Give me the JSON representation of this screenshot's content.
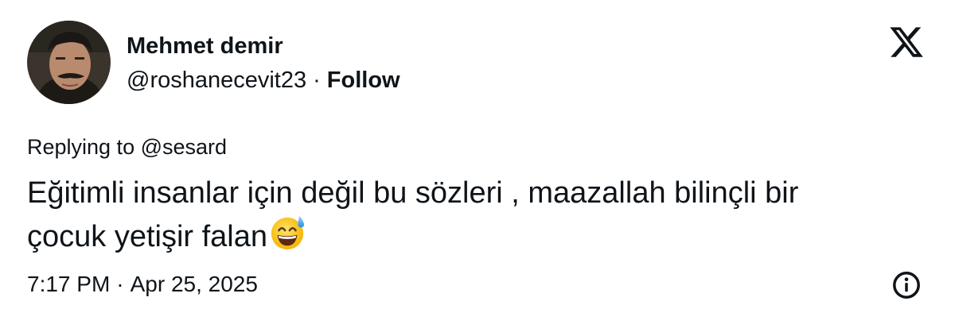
{
  "author": {
    "display_name": "Mehmet demir",
    "handle": "@roshanecevit23",
    "separator": "·",
    "follow_label": "Follow"
  },
  "brand": {
    "logo_icon": "x-logo-icon"
  },
  "tweet": {
    "replying_to": "Replying to @sesard",
    "line1": "Eğitimli insanlar için değil bu sözleri , maazallah bilinçli bir",
    "line2": "çocuk yetişir falan",
    "emoji": "grinning-face-with-sweat-emoji",
    "time": "7:17 PM",
    "separator": "·",
    "date": "Apr 25, 2025"
  },
  "actions": {
    "info_icon": "info-icon"
  },
  "colors": {
    "text": "#0f1419",
    "background": "#ffffff"
  }
}
